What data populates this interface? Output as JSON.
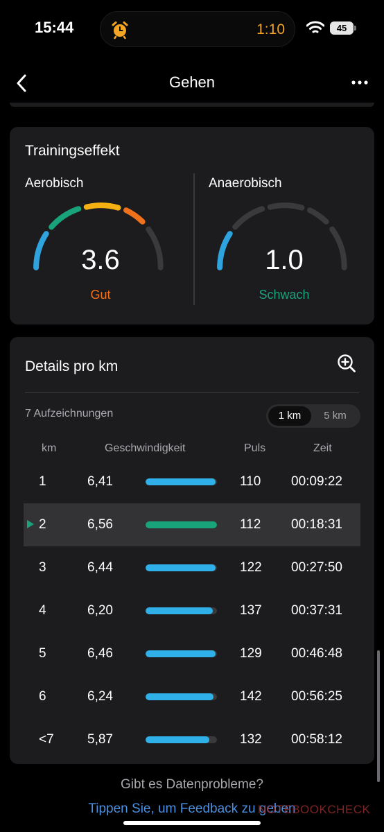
{
  "status_bar": {
    "time": "15:44",
    "timer": "1:10",
    "battery": "45",
    "timer_color": "#f5a524"
  },
  "nav": {
    "title": "Gehen",
    "back_icon": "chevron-left-icon",
    "more_icon": "ellipsis-icon"
  },
  "training_effect": {
    "title": "Trainingseffekt",
    "aerobic": {
      "label": "Aerobisch",
      "value": "3.6",
      "status": "Gut",
      "status_color": "#f0711c"
    },
    "anaerobic": {
      "label": "Anaerobisch",
      "value": "1.0",
      "status": "Schwach",
      "status_color": "#19a37a"
    }
  },
  "details": {
    "title": "Details pro km",
    "records": "7 Aufzeichnungen",
    "segments": {
      "active": "1 km",
      "inactive": "5 km"
    },
    "columns": {
      "km": "km",
      "speed": "Geschwindigkeit",
      "pulse": "Puls",
      "time": "Zeit"
    },
    "rows": [
      {
        "km": "1",
        "speed": "6,41",
        "pulse": "110",
        "time": "00:09:22",
        "bar": 0.98
      },
      {
        "km": "2",
        "speed": "6,56",
        "pulse": "112",
        "time": "00:18:31",
        "bar": 1.0,
        "selected": true
      },
      {
        "km": "3",
        "speed": "6,44",
        "pulse": "122",
        "time": "00:27:50",
        "bar": 0.98
      },
      {
        "km": "4",
        "speed": "6,20",
        "pulse": "137",
        "time": "00:37:31",
        "bar": 0.94
      },
      {
        "km": "5",
        "speed": "6,46",
        "pulse": "129",
        "time": "00:46:48",
        "bar": 0.98
      },
      {
        "km": "6",
        "speed": "6,24",
        "pulse": "142",
        "time": "00:56:25",
        "bar": 0.95
      },
      {
        "km": "<7",
        "speed": "5,87",
        "pulse": "132",
        "time": "00:58:12",
        "bar": 0.89
      }
    ],
    "bar_color": "#2fb0e8",
    "selected_bar_color": "#19a37a"
  },
  "footer": {
    "question": "Gibt es Datenprobleme?",
    "link": "Tippen Sie, um Feedback zu geben"
  },
  "watermark": "NOTEBOOKCHECK"
}
